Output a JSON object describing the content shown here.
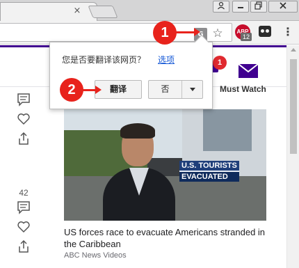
{
  "tabstrip": {
    "tab_close_glyph": "×"
  },
  "toolbar": {
    "translate_icon_glyph": "G",
    "star_glyph": "☆",
    "abp_label": "ABP",
    "abp_badge": "12",
    "menu_glyph": "⋮"
  },
  "translate_popup": {
    "question": "您是否要翻译该网页？",
    "options_link": "选项",
    "translate_button": "翻译",
    "no_button": "否"
  },
  "callouts": {
    "step1": "1",
    "step2": "2"
  },
  "page": {
    "notification_count": "1",
    "section_label": "Must Watch",
    "side_top": {
      "count": ""
    },
    "side_bottom": {
      "count": "42"
    },
    "video": {
      "lower_third_line1": "U.S. TOURISTS",
      "lower_third_line2": "EVACUATED"
    },
    "article": {
      "headline": "US forces race to evacuate Americans stranded in the Caribbean",
      "source": "ABC News Videos"
    }
  },
  "colors": {
    "brand_purple": "#400090",
    "callout_red": "#e8231c",
    "link_blue": "#1558d6",
    "badge_red": "#e0292f"
  },
  "icons": [
    "close-icon",
    "user-icon",
    "minimize-icon",
    "maximize-icon",
    "window-close-icon",
    "translate-icon",
    "star-icon",
    "adblock-icon",
    "extension-icon",
    "menu-icon",
    "bell-icon",
    "mail-icon",
    "comment-icon",
    "heart-icon",
    "share-icon"
  ]
}
